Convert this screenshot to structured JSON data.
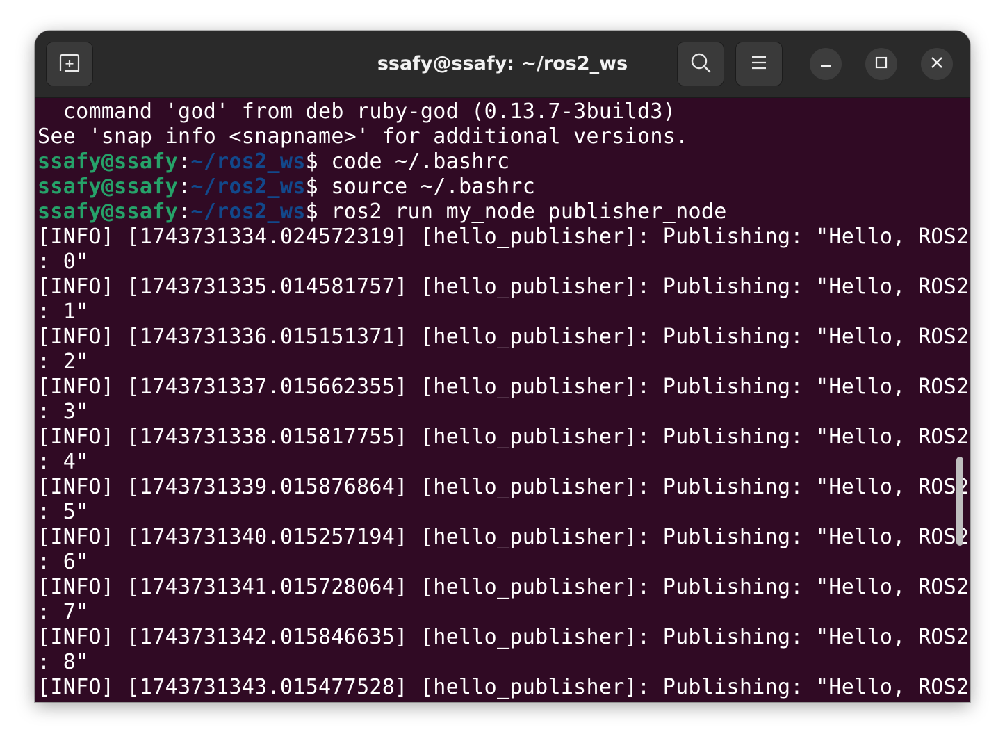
{
  "window": {
    "title": "ssafy@ssafy: ~/ros2_ws"
  },
  "titlebar": {
    "new_tab_icon": "new-tab-icon",
    "search_icon": "search-icon",
    "menu_icon": "hamburger-menu-icon",
    "minimize_icon": "minimize-icon",
    "maximize_icon": "maximize-icon",
    "close_icon": "close-icon"
  },
  "colors": {
    "terminal_bg": "#300a24",
    "titlebar_bg": "#2a2a2a",
    "prompt_user": "#26a269",
    "prompt_path": "#12488b",
    "text": "#ffffff"
  },
  "terminal": {
    "lines": [
      {
        "type": "out",
        "text": "  command 'god' from deb ruby-god (0.13.7-3build3)"
      },
      {
        "type": "out",
        "text": "See 'snap info <snapname>' for additional versions."
      },
      {
        "type": "prompt",
        "user": "ssafy@ssafy",
        "sep": ":",
        "path": "~/ros2_ws",
        "sym": "$",
        "cmd": " code ~/.bashrc"
      },
      {
        "type": "prompt",
        "user": "ssafy@ssafy",
        "sep": ":",
        "path": "~/ros2_ws",
        "sym": "$",
        "cmd": " source ~/.bashrc"
      },
      {
        "type": "prompt",
        "user": "ssafy@ssafy",
        "sep": ":",
        "path": "~/ros2_ws",
        "sym": "$",
        "cmd": " ros2 run my_node publisher_node"
      },
      {
        "type": "out",
        "text": "[INFO] [1743731334.024572319] [hello_publisher]: Publishing: \"Hello, ROS2"
      },
      {
        "type": "out",
        "text": ": 0\""
      },
      {
        "type": "out",
        "text": "[INFO] [1743731335.014581757] [hello_publisher]: Publishing: \"Hello, ROS2"
      },
      {
        "type": "out",
        "text": ": 1\""
      },
      {
        "type": "out",
        "text": "[INFO] [1743731336.015151371] [hello_publisher]: Publishing: \"Hello, ROS2"
      },
      {
        "type": "out",
        "text": ": 2\""
      },
      {
        "type": "out",
        "text": "[INFO] [1743731337.015662355] [hello_publisher]: Publishing: \"Hello, ROS2"
      },
      {
        "type": "out",
        "text": ": 3\""
      },
      {
        "type": "out",
        "text": "[INFO] [1743731338.015817755] [hello_publisher]: Publishing: \"Hello, ROS2"
      },
      {
        "type": "out",
        "text": ": 4\""
      },
      {
        "type": "out",
        "text": "[INFO] [1743731339.015876864] [hello_publisher]: Publishing: \"Hello, ROS2"
      },
      {
        "type": "out",
        "text": ": 5\""
      },
      {
        "type": "out",
        "text": "[INFO] [1743731340.015257194] [hello_publisher]: Publishing: \"Hello, ROS2"
      },
      {
        "type": "out",
        "text": ": 6\""
      },
      {
        "type": "out",
        "text": "[INFO] [1743731341.015728064] [hello_publisher]: Publishing: \"Hello, ROS2"
      },
      {
        "type": "out",
        "text": ": 7\""
      },
      {
        "type": "out",
        "text": "[INFO] [1743731342.015846635] [hello_publisher]: Publishing: \"Hello, ROS2"
      },
      {
        "type": "out",
        "text": ": 8\""
      },
      {
        "type": "out",
        "text": "[INFO] [1743731343.015477528] [hello_publisher]: Publishing: \"Hello, ROS2"
      }
    ]
  }
}
